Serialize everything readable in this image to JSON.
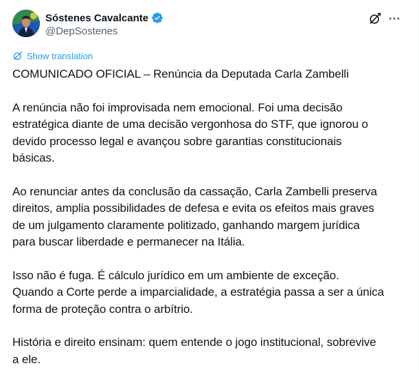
{
  "author": {
    "display_name": "Sóstenes Cavalcante",
    "handle": "@DepSostenes",
    "verified": true
  },
  "actions": {
    "grok_icon": "grok-icon",
    "more_icon": "more-icon"
  },
  "translate": {
    "label": "Show translation"
  },
  "post": {
    "title": "COMUNICADO OFICIAL – Renúncia da Deputada Carla Zambelli",
    "paragraph_1_lines": [
      "A renúncia não foi improvisada nem emocional. Foi uma decisão",
      "estratégica diante de uma decisão vergonhosa do STF, que ignorou o",
      "devido processo legal e avançou sobre garantias constitucionais",
      "básicas."
    ],
    "paragraph_2_lines": [
      "Ao renunciar antes da conclusão da cassação, Carla Zambelli preserva",
      "direitos, amplia possibilidades de defesa e evita os efeitos mais graves",
      "de um julgamento claramente politizado, ganhando margem jurídica",
      "para buscar liberdade e permanecer na Itália."
    ],
    "paragraph_3_lines": [
      "Isso não é fuga. É cálculo jurídico em um ambiente de exceção.",
      "Quando a Corte perde a imparcialidade, a estratégia passa a ser a única",
      "forma de proteção contra o arbítrio."
    ],
    "paragraph_4_lines": [
      "História e direito ensinam: quem entende o jogo institucional, sobrevive",
      "a ele."
    ]
  },
  "colors": {
    "text": "#0f1419",
    "secondary": "#536471",
    "link": "#1d9bf0",
    "verified": "#1d9bf0"
  }
}
